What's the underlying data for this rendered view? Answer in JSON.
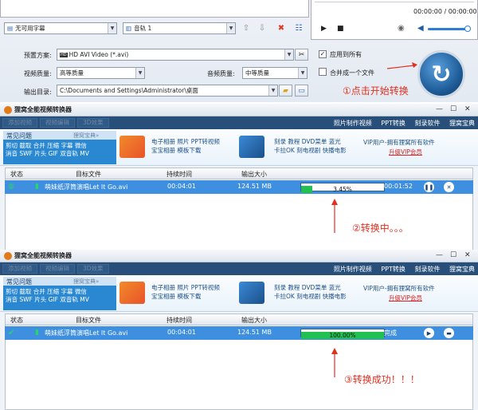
{
  "top_panel": {
    "subtitle_select": "无可用字幕",
    "audio_track_select": "音轨 1",
    "player_time": "00:00:00 / 00:00:00",
    "preset_label": "预置方案:",
    "preset_value": "HD AVI Video (*.avi)",
    "apply_all_label": "应用到所有",
    "video_quality_label": "视频质量:",
    "video_quality_value": "高等质量",
    "audio_quality_label": "音频质量:",
    "audio_quality_value": "中等质量",
    "merge_label": "合并成一个文件",
    "output_dir_label": "输出目录:",
    "output_dir_value": "C:\\Documents and Settings\\Administrator\\桌面"
  },
  "annotations": {
    "step1": "①点击开始转换",
    "step2": "②转换中。。。",
    "step3": "③转换成功！！！"
  },
  "windows": [
    {
      "title": "狸窝全能视频转换器",
      "tabs": [
        "添加视频",
        "视频编辑",
        "3D效果"
      ],
      "menu_right": [
        "照片制作视频",
        "PPT转换",
        "刻录软件",
        "狸窝宝典"
      ],
      "faq_tab": "常见问题",
      "faq_tab_right": "狸窝宝典»",
      "chips": "剪切 截取 合并 压缩 字幕 微信\n消音 SWF 片头 GIF 双音轨 MV",
      "links1": "电子相册 照片 PPT转视频\n宝宝相册 模板下载",
      "links2": "刻录 教程 DVD菜单 蓝光\n卡拉OK 刻电视剧 快播电影",
      "vip_text": "VIP用户-拥有狸窝所有软件",
      "vip_link": "升级VIP会员",
      "columns": [
        "状态",
        "目标文件",
        "持续时间",
        "输出大小"
      ],
      "row": {
        "file": "萌妹纸浮筒演唱Let It Go.avi",
        "duration": "00:04:01",
        "size": "124.51 MB",
        "percent": "3.45%",
        "progress": 0.0345,
        "status": "00:01:52"
      }
    },
    {
      "title": "狸窝全能视频转换器",
      "tabs": [
        "添加视频",
        "视频编辑",
        "3D效果"
      ],
      "menu_right": [
        "照片制作视频",
        "PPT转换",
        "刻录软件",
        "狸窝宝典"
      ],
      "faq_tab": "常见问题",
      "faq_tab_right": "狸窝宝典»",
      "chips": "剪切 截取 合并 压缩 字幕 微信\n消音 SWF 片头 GIF 双音轨 MV",
      "links1": "电子相册 照片 PPT转视频\n宝宝相册 模板下载",
      "links2": "刻录 教程 DVD菜单 蓝光\n卡拉OK 刻电视剧 快播电影",
      "vip_text": "VIP用户-拥有狸窝所有软件",
      "vip_link": "升级VIP会员",
      "columns": [
        "状态",
        "目标文件",
        "持续时间",
        "输出大小"
      ],
      "row": {
        "file": "萌妹纸浮筒演唱Let It Go.avi",
        "duration": "00:04:01",
        "size": "124.51 MB",
        "percent": "100.00%",
        "progress": 1.0,
        "status": "完成"
      }
    }
  ],
  "colors": {
    "accent": "#3e8fe0",
    "menubar": "#274f7a",
    "progress": "#21c050",
    "annotation": "#e03020"
  }
}
